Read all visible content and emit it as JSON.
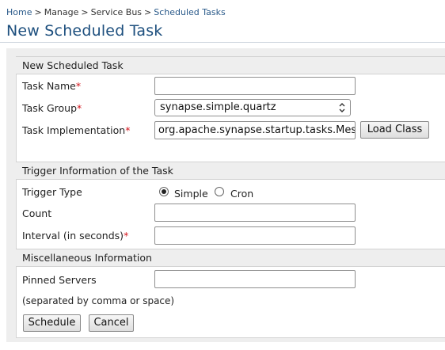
{
  "breadcrumb": {
    "home": "Home",
    "sep": ">",
    "manage": "Manage",
    "service_bus": "Service Bus",
    "current": "Scheduled Tasks"
  },
  "page_title": "New Scheduled Task",
  "sections": {
    "task": "New Scheduled Task",
    "trigger": "Trigger Information of the Task",
    "misc": "Miscellaneous Information"
  },
  "fields": {
    "task_name": {
      "label": "Task Name",
      "required": "*",
      "value": ""
    },
    "task_group": {
      "label": "Task Group",
      "required": "*",
      "value": "synapse.simple.quartz"
    },
    "task_impl": {
      "label": "Task Implementation",
      "required": "*",
      "value": "org.apache.synapse.startup.tasks.Mes"
    },
    "trigger_type": {
      "label": "Trigger Type",
      "options": [
        "Simple",
        "Cron"
      ],
      "selected": "Simple"
    },
    "count": {
      "label": "Count",
      "value": ""
    },
    "interval": {
      "label": "Interval (in seconds)",
      "required": "*",
      "value": ""
    },
    "pinned": {
      "label": "Pinned Servers",
      "value": "",
      "note": "(separated by comma or space)"
    }
  },
  "buttons": {
    "load_class": "Load Class",
    "schedule": "Schedule",
    "cancel": "Cancel"
  },
  "colors": {
    "title": "#1d4f7e",
    "link": "#2a5a8a",
    "required": "#d4141c",
    "section_bg": "#eeeeee"
  }
}
